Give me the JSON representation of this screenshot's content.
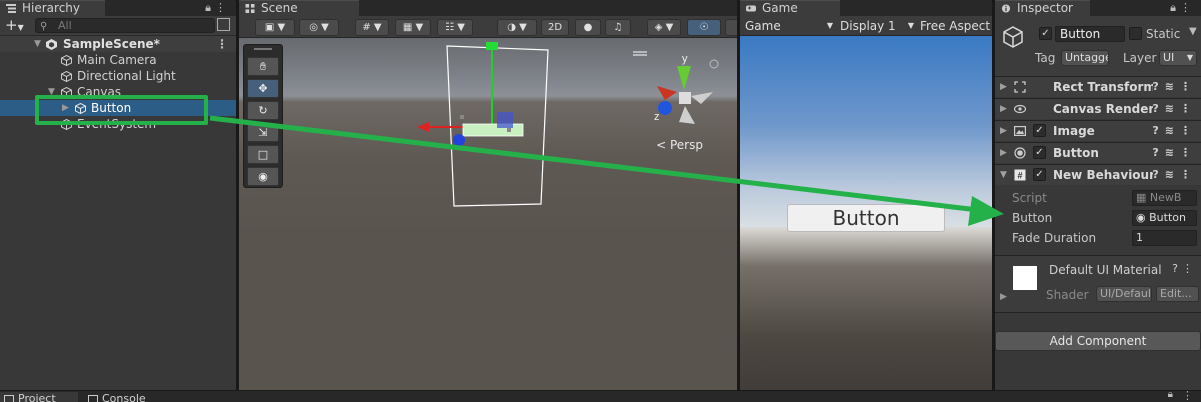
{
  "hierarchy": {
    "tab": "Hierarchy",
    "add": "+",
    "search_placeholder": "All",
    "tree": [
      {
        "label": "SampleScene*",
        "level": 0
      },
      {
        "label": "Main Camera",
        "level": 1
      },
      {
        "label": "Directional Light",
        "level": 1
      },
      {
        "label": "Canvas",
        "level": 1
      },
      {
        "label": "Button",
        "level": 2,
        "selected": true
      },
      {
        "label": "EventSystem",
        "level": 1
      }
    ]
  },
  "scene": {
    "tab": "Scene",
    "two_d": "2D",
    "persp": "< Persp",
    "gizmo_axes": {
      "y": "y",
      "z": "z"
    }
  },
  "game": {
    "tab": "Game",
    "mode": "Game",
    "display": "Display 1",
    "aspect": "Free Aspect",
    "button_label": "Button"
  },
  "inspector": {
    "tab": "Inspector",
    "object_name": "Button",
    "static_label": "Static",
    "tag_label": "Tag",
    "tag_value": "Untagged",
    "layer_label": "Layer",
    "layer_value": "UI",
    "components": [
      {
        "name": "Rect Transform",
        "checkbox": false
      },
      {
        "name": "Canvas Renderer",
        "checkbox": false
      },
      {
        "name": "Image",
        "checkbox": true
      },
      {
        "name": "Button",
        "checkbox": true
      },
      {
        "name": "New Behaviour Script",
        "checkbox": true
      }
    ],
    "props": {
      "script_label": "Script",
      "script_value": "NewB",
      "button_label": "Button",
      "button_value": "Button",
      "fade_label": "Fade Duration",
      "fade_value": "1"
    },
    "material": {
      "name": "Default UI Material",
      "shader_label": "Shader",
      "shader_value": "UI/Default",
      "edit": "Edit..."
    },
    "add_component": "Add Component"
  },
  "bottom": {
    "project_tab": "Project",
    "console_tab": "Console"
  },
  "colors": {
    "highlight": "#24b14a",
    "selection": "#2c5d87"
  }
}
